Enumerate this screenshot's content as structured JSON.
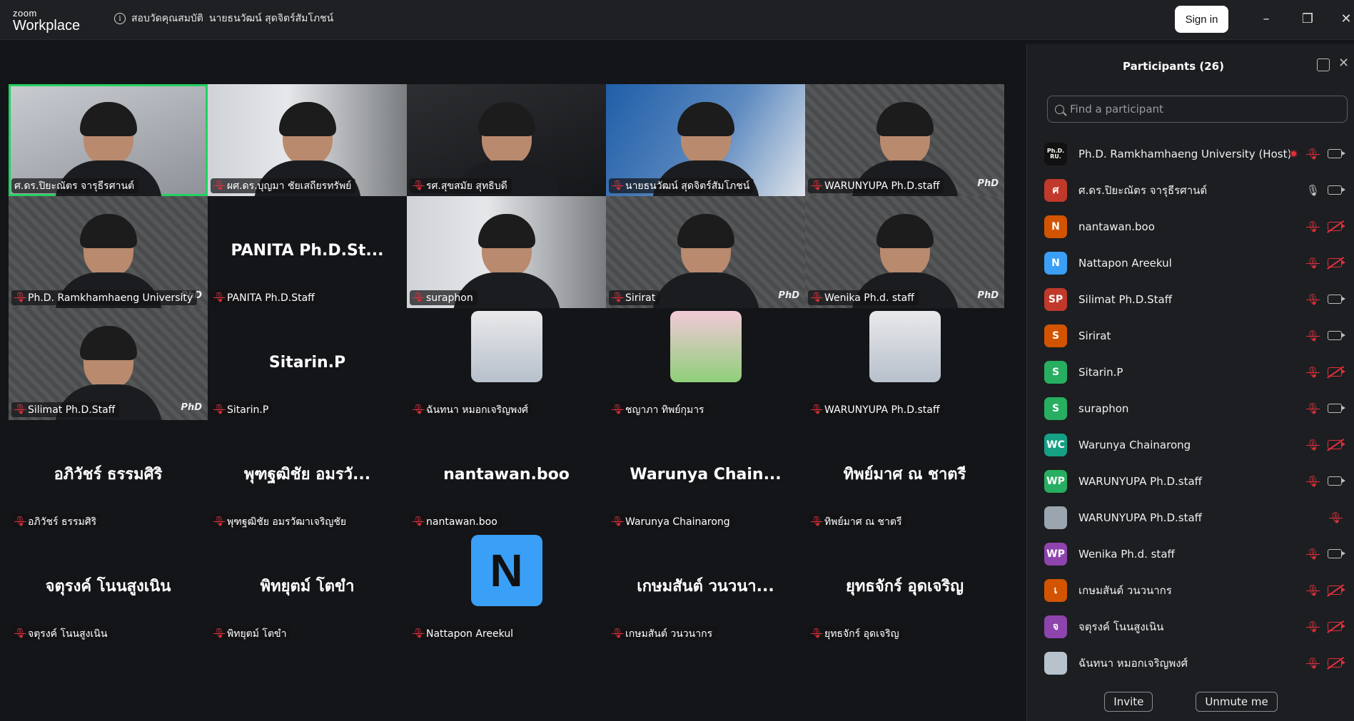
{
  "app": {
    "logo_top": "zoom",
    "logo_bottom": "Workplace"
  },
  "titlebar": {
    "info_label": "สอบวัดคุณสมบัติ",
    "meeting_owner": "นายธนวัฒน์ สุดจิตร์สัมโภชน์",
    "signin": "Sign in"
  },
  "tiles": [
    {
      "label": "ศ.ดร.ปิยะณัตร จารุธีรศานต์",
      "kind": "video",
      "style": "light",
      "muted": false,
      "active": true
    },
    {
      "label": "ผศ.ดร.บุญมา ชัยเสถียรทรัพย์",
      "kind": "video",
      "style": "room",
      "muted": true
    },
    {
      "label": "รศ.สุขสมัย สุทธิบดี",
      "kind": "video",
      "style": "dark",
      "muted": true
    },
    {
      "label": "นายธนวัฒน์ สุดจิตร์สัมโภชน์",
      "kind": "video",
      "style": "blue",
      "muted": true
    },
    {
      "label": "WARUNYUPA Ph.D.staff",
      "kind": "video",
      "style": "pattern",
      "muted": true
    },
    {
      "label": "Ph.D. Ramkhamhaeng University",
      "kind": "video",
      "style": "pattern",
      "muted": true
    },
    {
      "label": "PANITA Ph.D.Staff",
      "kind": "name",
      "display": "PANITA Ph.D.St...",
      "muted": true
    },
    {
      "label": "suraphon",
      "kind": "video",
      "style": "room",
      "muted": true
    },
    {
      "label": "Sirirat",
      "kind": "video",
      "style": "pattern",
      "muted": true
    },
    {
      "label": "Wenika Ph.d. staff",
      "kind": "video",
      "style": "pattern",
      "muted": true
    },
    {
      "label": "Silimat Ph.D.Staff",
      "kind": "video",
      "style": "pattern",
      "muted": true
    },
    {
      "label": "Sitarin.P",
      "kind": "name",
      "display": "Sitarin.P",
      "muted": true
    },
    {
      "label": "ฉันทนา หมอกเจริญพงศ์",
      "kind": "photo",
      "muted": true
    },
    {
      "label": "ชญาภา ทิพย์กุมาร",
      "kind": "photo",
      "muted": true
    },
    {
      "label": "WARUNYUPA Ph.D.staff",
      "kind": "photo",
      "muted": true
    },
    {
      "label": "อภิวัชร์ ธรรมศิริ",
      "kind": "name",
      "display": "อภิวัชร์ ธรรมศิริ",
      "muted": true
    },
    {
      "label": "พุฑฐฒิชัย อมรวัฒาเจริญชัย",
      "kind": "name",
      "display": "พุฑฐฒิชัย อมรวั...",
      "muted": true
    },
    {
      "label": "nantawan.boo",
      "kind": "name",
      "display": "nantawan.boo",
      "muted": true
    },
    {
      "label": "Warunya Chainarong",
      "kind": "name",
      "display": "Warunya Chain...",
      "muted": true
    },
    {
      "label": "ทิพย์มาศ ณ ชาตรี",
      "kind": "name",
      "display": "ทิพย์มาศ ณ ชาตรี",
      "muted": true
    },
    {
      "label": "จตุรงค์ โนนสูงเนิน",
      "kind": "name",
      "display": "จตุรงค์ โนนสูงเนิน",
      "muted": true
    },
    {
      "label": "พิทยุตม์ โตขำ",
      "kind": "name",
      "display": "พิทยุตม์ โตขำ",
      "muted": true
    },
    {
      "label": "Nattapon Areekul",
      "kind": "letter",
      "display": "N",
      "muted": true
    },
    {
      "label": "เกษมสันต์ วนวนากร",
      "kind": "name",
      "display": "เกษมสันต์ วนวนา...",
      "muted": true
    },
    {
      "label": "ยุทธจักร์ อุดเจริญ",
      "kind": "name",
      "display": "ยุทธจักร์ อุดเจริญ",
      "muted": true
    }
  ],
  "panel": {
    "title": "Participants (26)",
    "search_placeholder": "Find a participant",
    "participants": [
      {
        "name": "Ph.D. Ramkhamhaeng University (Host)",
        "avatar": "Ph.D. RU.",
        "color": "#111111",
        "mic": "off",
        "cam": "on",
        "rec": true
      },
      {
        "name": "ศ.ดร.ปิยะณัตร จารุธีรศานต์",
        "avatar": "ศ",
        "color": "#c0392b",
        "mic": "on",
        "cam": "on"
      },
      {
        "name": "nantawan.boo",
        "avatar": "N",
        "color": "#d35400",
        "mic": "off",
        "cam": "off"
      },
      {
        "name": "Nattapon Areekul",
        "avatar": "N",
        "color": "#3a9ff6",
        "mic": "off",
        "cam": "off"
      },
      {
        "name": "Silimat Ph.D.Staff",
        "avatar": "SP",
        "color": "#c0392b",
        "mic": "off",
        "cam": "on"
      },
      {
        "name": "Sirirat",
        "avatar": "S",
        "color": "#d35400",
        "mic": "off",
        "cam": "on"
      },
      {
        "name": "Sitarin.P",
        "avatar": "S",
        "color": "#27ae60",
        "mic": "off",
        "cam": "off"
      },
      {
        "name": "suraphon",
        "avatar": "S",
        "color": "#27ae60",
        "mic": "off",
        "cam": "on"
      },
      {
        "name": "Warunya Chainarong",
        "avatar": "WC",
        "color": "#16a085",
        "mic": "off",
        "cam": "off"
      },
      {
        "name": "WARUNYUPA Ph.D.staff",
        "avatar": "WP",
        "color": "#27ae60",
        "mic": "off",
        "cam": "on"
      },
      {
        "name": "WARUNYUPA Ph.D.staff",
        "avatar": "",
        "color": "#9aa5b0",
        "mic": "off",
        "cam": "none"
      },
      {
        "name": "Wenika Ph.d. staff",
        "avatar": "WP",
        "color": "#8e44ad",
        "mic": "off",
        "cam": "on"
      },
      {
        "name": "เกษมสันต์ วนวนากร",
        "avatar": "เ",
        "color": "#d35400",
        "mic": "off",
        "cam": "off"
      },
      {
        "name": "จตุรงค์ โนนสูงเนิน",
        "avatar": "จ",
        "color": "#8e44ad",
        "mic": "off",
        "cam": "off"
      },
      {
        "name": "ฉันทนา หมอกเจริญพงศ์",
        "avatar": "",
        "color": "#b8c2cc",
        "mic": "off",
        "cam": "off"
      }
    ],
    "invite": "Invite",
    "unmute": "Unmute me"
  }
}
